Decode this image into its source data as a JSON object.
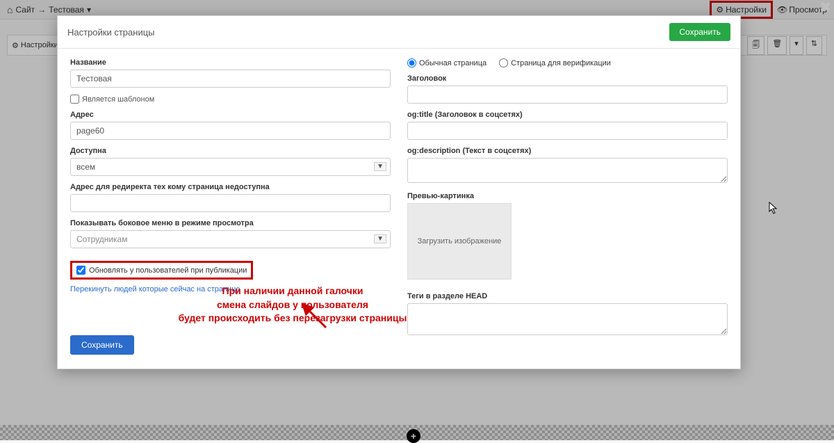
{
  "topbar": {
    "breadcrumb_site": "Сайт",
    "breadcrumb_page": "Тестовая",
    "settings_btn": "Настройки",
    "preview_btn": "Просмотр"
  },
  "bg_toolbar": {
    "settings_label": "Настройки"
  },
  "modal": {
    "title": "Настройки страницы",
    "save_top": "Сохранить",
    "save_bottom": "Сохранить",
    "left": {
      "name_label": "Название",
      "name_value": "Тестовая",
      "is_template_label": "Является шаблоном",
      "address_label": "Адрес",
      "address_value": "page60",
      "available_label": "Доступна",
      "available_value": "всем",
      "redirect_label": "Адрес для редиректа тех кому страница недоступна",
      "redirect_value": "",
      "sidemenu_label": "Показывать боковое меню в режиме просмотра",
      "sidemenu_value": "Сотрудникам",
      "update_checkbox_label": "Обновлять у пользователей при публикации",
      "redirect_users_link": "Перекинуть людей которые сейчас на странице"
    },
    "right": {
      "radio_normal": "Обычная страница",
      "radio_verify": "Страница для верификации",
      "heading_label": "Заголовок",
      "ogtitle_label": "og:title (Заголовок в соцсетях)",
      "ogdesc_label": "og:description (Текст в соцсетях)",
      "preview_label": "Превью-картинка",
      "upload_text": "Загрузить изображение",
      "headtags_label": "Теги в разделе HEAD"
    }
  },
  "annotation": {
    "line1": "При наличии данной галочки",
    "line2": "смена слайдов у пользователя",
    "line3": "будет происходить без перезагрузки страницы"
  }
}
